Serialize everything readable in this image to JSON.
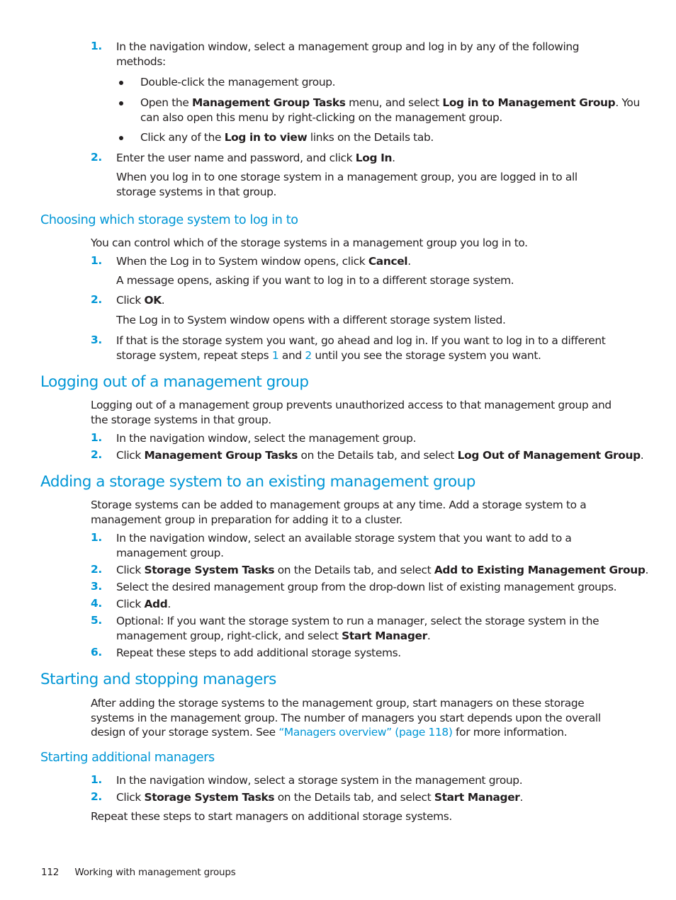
{
  "colors": {
    "accent": "#0096d6",
    "text": "#231f20"
  },
  "intro_steps": {
    "step1": {
      "num": "1.",
      "text_line1": "In the navigation window, select a management group and log in by any of the following",
      "text_line2": "methods:",
      "bullets": [
        {
          "pre": "Double-click the management group.",
          "bold": "",
          "mid": "",
          "bold2": "",
          "post": ""
        },
        {
          "pre": "Open the ",
          "bold": "Management Group Tasks",
          "mid": " menu, and select ",
          "bold2": "Log in to Management Group",
          "post": ". You",
          "line2": "can also open this menu by right-clicking on the management group."
        },
        {
          "pre": "Click any of the ",
          "bold": "Log in to view",
          "mid": " links on the Details tab.",
          "bold2": "",
          "post": ""
        }
      ]
    },
    "step2": {
      "num": "2.",
      "pre": "Enter the user name and password, and click ",
      "bold": "Log In",
      "post": ".",
      "note_line1": "When you log in to one storage system in a management group, you are logged in to all",
      "note_line2": "storage systems in that group."
    }
  },
  "section_choosing": {
    "heading": "Choosing which storage system to log in to",
    "intro": "You can control which of the storage systems in a management group you log in to.",
    "steps": [
      {
        "num": "1.",
        "pre": "When the Log in to System window opens, click ",
        "bold": "Cancel",
        "post": ".",
        "note": "A message opens, asking if you want to log in to a different storage system."
      },
      {
        "num": "2.",
        "pre": "Click ",
        "bold": "OK",
        "post": ".",
        "note": "The Log in to System window opens with a different storage system listed."
      },
      {
        "num": "3.",
        "line1": "If that is the storage system you want, go ahead and log in. If you want to log in to a different",
        "line2_pre": "storage system, repeat steps ",
        "link1": "1",
        "line2_mid": " and ",
        "link2": "2",
        "line2_post": " until you see the storage system you want."
      }
    ]
  },
  "section_logout": {
    "heading": "Logging out of a management group",
    "intro_line1": "Logging out of a management group prevents unauthorized access to that management group and",
    "intro_line2": "the storage systems in that group.",
    "steps": [
      {
        "num": "1.",
        "text": "In the navigation window, select the management group."
      },
      {
        "num": "2.",
        "pre": "Click ",
        "bold": "Management Group Tasks",
        "mid": " on the Details tab, and select ",
        "bold2": "Log Out of Management Group",
        "post": "."
      }
    ]
  },
  "section_adding": {
    "heading": "Adding a storage system to an existing management group",
    "intro_line1": "Storage systems can be added to management groups at any time. Add a storage system to a",
    "intro_line2": "management group in preparation for adding it to a cluster.",
    "steps": [
      {
        "num": "1.",
        "line1": "In the navigation window, select an available storage system that you want to add to a",
        "line2": "management group."
      },
      {
        "num": "2.",
        "pre": "Click ",
        "bold": "Storage System Tasks",
        "mid": " on the Details tab, and select ",
        "bold2": "Add to Existing Management Group",
        "post": "."
      },
      {
        "num": "3.",
        "text": "Select the desired management group from the drop-down list of existing management groups."
      },
      {
        "num": "4.",
        "pre": "Click ",
        "bold": "Add",
        "post": "."
      },
      {
        "num": "5.",
        "line1": "Optional: If you want the storage system to run a manager, select the storage system in the",
        "line2_pre": "management group, right-click, and select ",
        "bold": "Start Manager",
        "post": "."
      },
      {
        "num": "6.",
        "text": "Repeat these steps to add additional storage systems."
      }
    ]
  },
  "section_starting": {
    "heading": "Starting and stopping managers",
    "line1": "After adding the storage systems to the management group, start managers on these storage",
    "line2": "systems in the management group. The number of managers you start depends upon the overall",
    "line3_pre": "design of your storage system. See ",
    "link": "“Managers overview” (page 118)",
    "line3_post": " for more information."
  },
  "section_additional": {
    "heading": "Starting additional managers",
    "steps": [
      {
        "num": "1.",
        "text": "In the navigation window, select a storage system in the management group."
      },
      {
        "num": "2.",
        "pre": "Click ",
        "bold": "Storage System Tasks",
        "mid": " on the Details tab, and select ",
        "bold2": "Start Manager",
        "post": "."
      }
    ],
    "closing": "Repeat these steps to start managers on additional storage systems."
  },
  "footer": {
    "page_number": "112",
    "chapter_title": "Working with management groups"
  }
}
